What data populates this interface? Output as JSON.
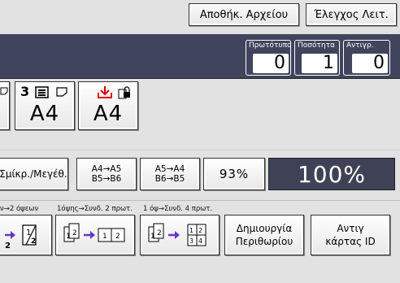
{
  "topbar": {
    "store_file_label": "Αποθήκ. Αρχείου",
    "check_modes_label": "Έλεγχος Λειτ."
  },
  "counters": [
    {
      "label": "Πρωτότυπο",
      "value": "0"
    },
    {
      "label": "Ποσότητα",
      "value": "1"
    },
    {
      "label": "Αντιγρ.",
      "value": "0"
    }
  ],
  "trays": [
    {
      "tray_number": "3",
      "paper_size": "A4"
    },
    {
      "paper_size": "A4"
    }
  ],
  "reduce_enlarge": {
    "zoom_label": "Σμίκρ./Μεγέθ.",
    "preset1_line1": "A4→A5",
    "preset1_line2": "B5→B6",
    "preset2_line1": "A5→A4",
    "preset2_line2": "B6→B5",
    "preset_percent": "93%",
    "current_ratio": "100%"
  },
  "captions": {
    "c1": "ν→2 όψεων",
    "c2": "1όψης→Συνδ. 2 πρωτ.",
    "c3": "1 όψ→Συνδ. 4 πρωτ."
  },
  "bottom": {
    "margin_line1": "Δημιουργία",
    "margin_line2": "Περιθωρίου",
    "idcard_line1": "Αντιγ",
    "idcard_line2": "κάρτας ID"
  },
  "colors": {
    "dark_panel": "#41445d",
    "arrow": "#6a35c8",
    "bypass_arrow": "#e00000"
  }
}
